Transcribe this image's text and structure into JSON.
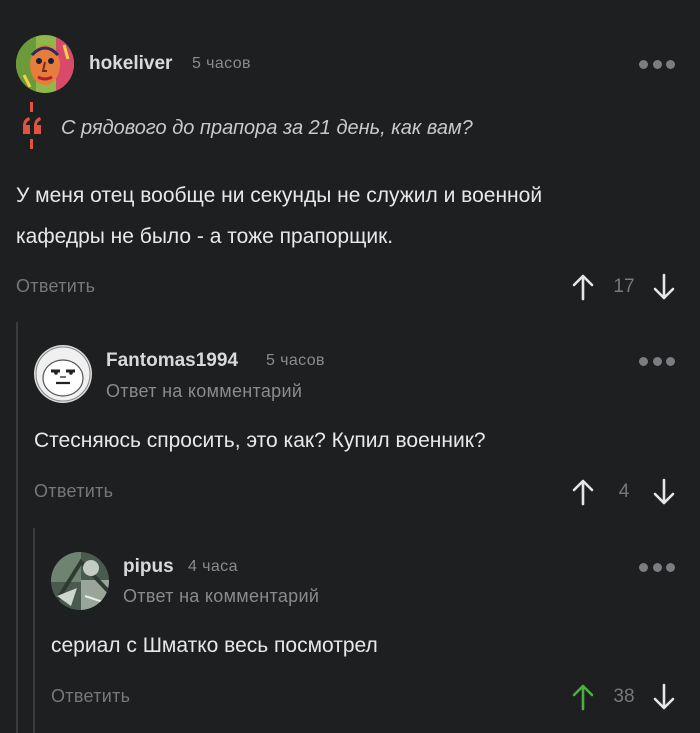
{
  "colors": {
    "background": "#1e1f21",
    "quote_accent": "#e0533e",
    "upvote_active": "#4caf3f",
    "muted": "#8a8b8d"
  },
  "comments": [
    {
      "username": "hokeliver",
      "time": "5 часов",
      "quote": "С рядового до прапора за 21 день, как вам?",
      "body_lines": [
        "У меня отец вообще ни секунды не служил и военной",
        "кафедры не было - а тоже прапорщик."
      ],
      "reply_label": "Ответить",
      "rating": "17",
      "upvoted": false,
      "menu_icon": "more-dots-icon"
    },
    {
      "username": "Fantomas1994",
      "time": "5 часов",
      "subtitle": "Ответ на комментарий",
      "body_lines": [
        "Стесняюсь спросить, это как? Купил военник?"
      ],
      "reply_label": "Ответить",
      "rating": "4",
      "upvoted": false,
      "menu_icon": "more-dots-icon"
    },
    {
      "username": "pipus",
      "time": "4 часа",
      "subtitle": "Ответ на комментарий",
      "body_lines": [
        "сериал с Шматко весь посмотрел"
      ],
      "reply_label": "Ответить",
      "rating": "38",
      "upvoted": true,
      "menu_icon": "more-dots-icon"
    }
  ]
}
